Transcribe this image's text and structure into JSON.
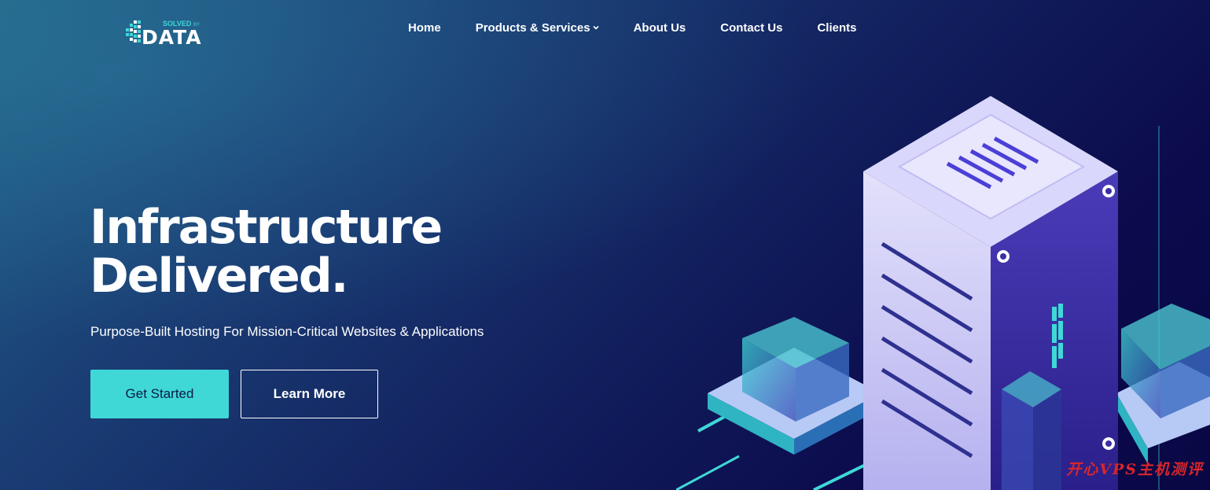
{
  "brand": {
    "logo_small_text": "SOLVED",
    "logo_by_text": "BY",
    "logo_main_text": "DATA",
    "accent_color": "#3fd8d6"
  },
  "nav": {
    "items": [
      {
        "label": "Home"
      },
      {
        "label": "Products & Services",
        "has_dropdown": true,
        "icon": "chevron-down-icon"
      },
      {
        "label": "About Us"
      },
      {
        "label": "Contact Us"
      },
      {
        "label": "Clients"
      }
    ]
  },
  "hero": {
    "title_line1": "Infrastructure",
    "title_line2": "Delivered.",
    "subtitle": "Purpose-Built Hosting For Mission-Critical Websites & Applications",
    "primary_button": "Get Started",
    "secondary_button": "Learn More"
  },
  "watermark": {
    "text": "开心VPS主机测评"
  },
  "colors": {
    "background_start": "#226489",
    "background_end": "#090744",
    "server_face": "#c9c6f6",
    "server_side": "#3b2fa6",
    "accent_teal": "#3fd8d6"
  }
}
